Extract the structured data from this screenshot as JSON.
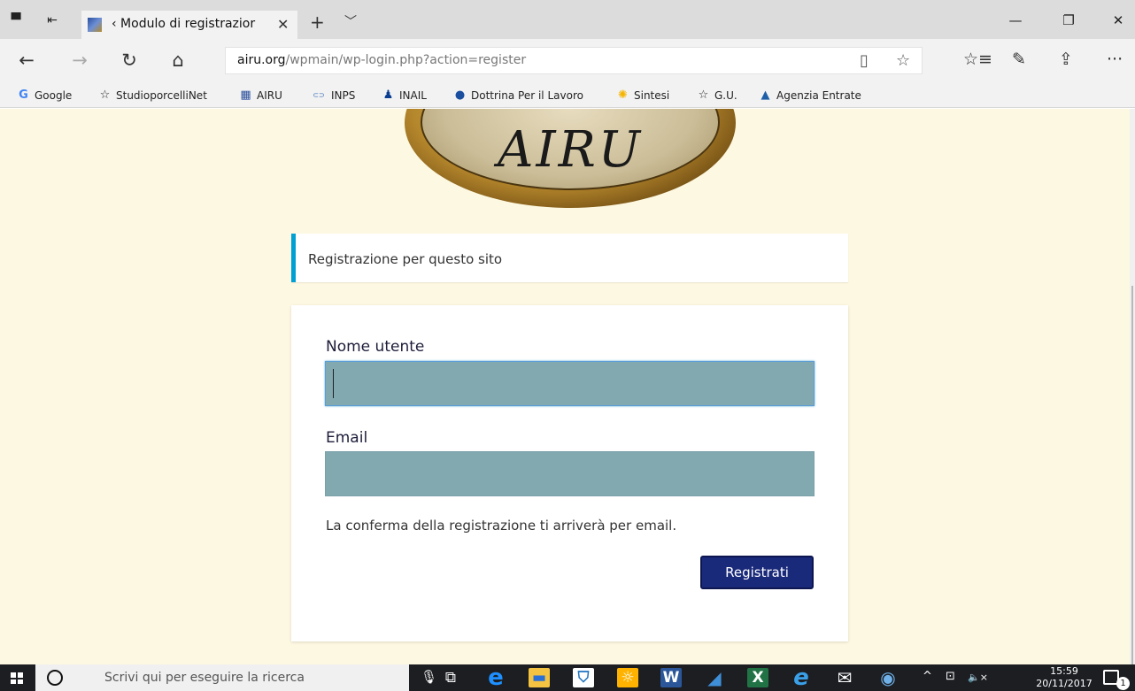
{
  "browser": {
    "tab": {
      "title": "‹ Modulo di registrazior",
      "close": "✕",
      "favicon": "airu-favicon-icon"
    },
    "new_tab": "+",
    "tab_menu": "﹀",
    "window_controls": {
      "minimize": "—",
      "restore": "❐",
      "close": "✕"
    },
    "nav": {
      "back": "←",
      "forward": "→",
      "refresh": "↻",
      "home": "⌂"
    },
    "address": {
      "host": "airu.org",
      "path": "/wpmain/wp-login.php?action=register"
    },
    "address_icons": {
      "reading_view": "▯",
      "favorite": "☆"
    },
    "tools": {
      "favorites_hub": "☆≡",
      "notes": "✎",
      "share": "⇪",
      "more": "···"
    },
    "favorites": [
      {
        "label": "Google",
        "icon": "G",
        "color": "#4285f4"
      },
      {
        "label": "StudioporcelliNet",
        "icon": "☆",
        "color": "#333333"
      },
      {
        "label": "AIRU",
        "icon": "▦",
        "color": "#2a4f9c"
      },
      {
        "label": "INPS",
        "icon": "⊂⊃",
        "color": "#3b6fb5"
      },
      {
        "label": "INAIL",
        "icon": "♟",
        "color": "#0b3d91"
      },
      {
        "label": "Dottrina Per il Lavoro",
        "icon": "●",
        "color": "#1a4fa0"
      },
      {
        "label": "Sintesi",
        "icon": "✺",
        "color": "#f5b400"
      },
      {
        "label": "G.U.",
        "icon": "☆",
        "color": "#333333"
      },
      {
        "label": "Agenzia Entrate",
        "icon": "▲",
        "color": "#1f5fa8"
      }
    ]
  },
  "page": {
    "logo_text": "AIRU",
    "message": "Registrazione per questo sito",
    "form": {
      "username_label": "Nome utente",
      "username_value": "",
      "email_label": "Email",
      "email_value": "",
      "note": "La conferma della registrazione ti arriverà per email.",
      "submit_label": "Registrati"
    }
  },
  "taskbar": {
    "search_placeholder": "Scrivi qui per eseguire la ricerca",
    "apps": [
      {
        "name": "task-view-icon",
        "glyph": "⧉",
        "bg": "transparent",
        "fg": "#ffffff"
      },
      {
        "name": "edge-icon",
        "glyph": "e",
        "bg": "transparent",
        "fg": "#1e90ff"
      },
      {
        "name": "file-explorer-icon",
        "glyph": "▬",
        "bg": "#f5c342",
        "fg": "#2a6fd6"
      },
      {
        "name": "store-icon",
        "glyph": "⛉",
        "bg": "#ffffff",
        "fg": "#1e73be"
      },
      {
        "name": "photos-icon",
        "glyph": "☼",
        "bg": "#ffb300",
        "fg": "#ffffff"
      },
      {
        "name": "word-icon",
        "glyph": "W",
        "bg": "#2b579a",
        "fg": "#ffffff"
      },
      {
        "name": "onenote-icon",
        "glyph": "◢",
        "bg": "transparent",
        "fg": "#3f8fd8"
      },
      {
        "name": "excel-icon",
        "glyph": "X",
        "bg": "#217346",
        "fg": "#ffffff"
      },
      {
        "name": "internet-explorer-icon",
        "glyph": "e",
        "bg": "transparent",
        "fg": "#3aa0e8"
      },
      {
        "name": "mail-icon",
        "glyph": "✉",
        "bg": "transparent",
        "fg": "#ffffff"
      },
      {
        "name": "chat-icon",
        "glyph": "◉",
        "bg": "transparent",
        "fg": "#6fb1e8"
      }
    ],
    "tray": {
      "chevron": "^",
      "network": "⊡",
      "volume": "🔈×"
    },
    "time": "15:59",
    "date": "20/11/2017",
    "notification_count": "1"
  }
}
